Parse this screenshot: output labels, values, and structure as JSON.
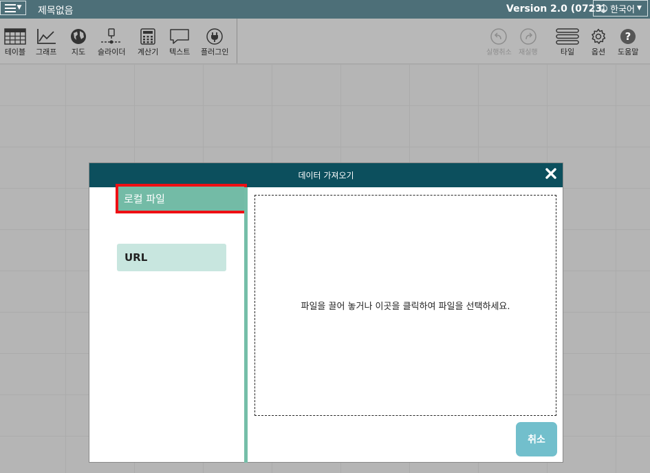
{
  "titlebar": {
    "doc_title": "제목없음",
    "version": "Version 2.0 (0723)",
    "language": "한국어"
  },
  "toolbar": {
    "table": "테이블",
    "graph": "그래프",
    "map": "지도",
    "slider": "슬라이더",
    "calculator": "계산기",
    "text": "텍스트",
    "plugin": "플러그인",
    "undo": "실행취소",
    "redo": "재실행",
    "tile": "타일",
    "options": "옵션",
    "help": "도움말"
  },
  "dialog": {
    "title": "데이터 가져오기",
    "tabs": {
      "local": "로컬 파일",
      "url": "URL"
    },
    "drop_text": "파일을 끌어 놓거나 이곳을 클릭하여 파일을 선택하세요.",
    "cancel": "취소"
  },
  "colors": {
    "titlebar": "#4d6f78",
    "dialog_header": "#0c4f5d",
    "accent_green": "#73bba6",
    "highlight_red": "#ee0f14",
    "cancel_button": "#72bfcc"
  }
}
